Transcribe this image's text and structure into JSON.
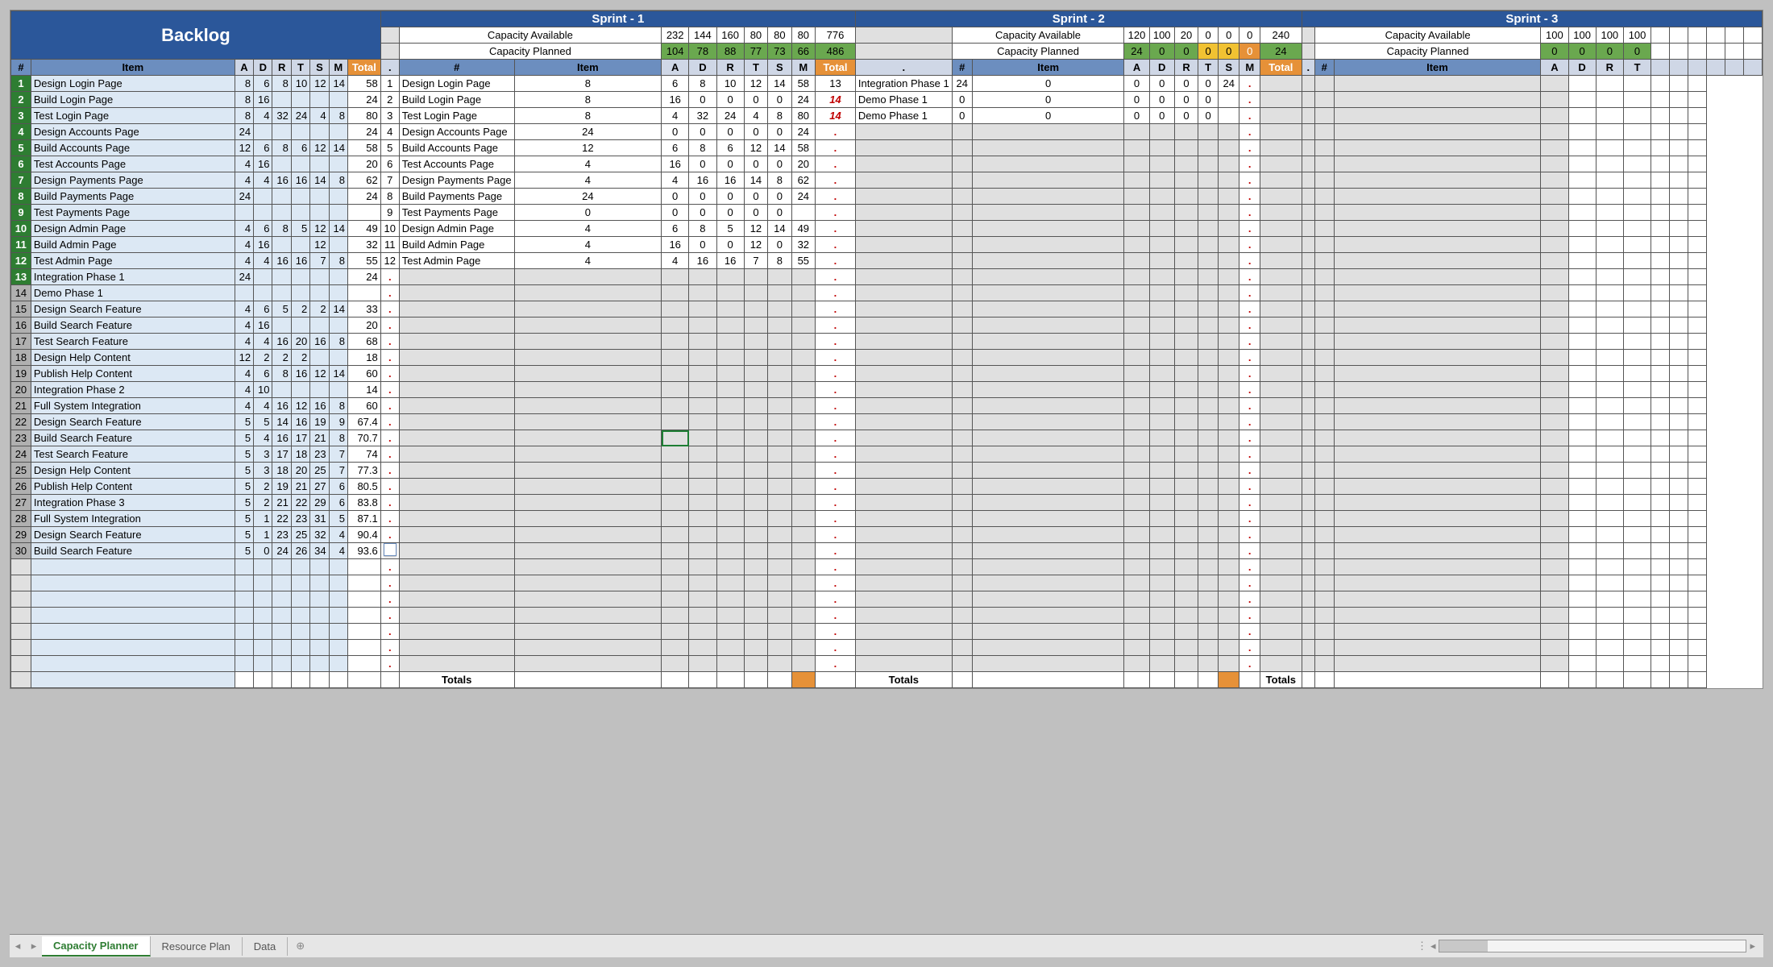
{
  "title": "Backlog",
  "sprints": [
    "Sprint - 1",
    "Sprint - 2",
    "Sprint - 3"
  ],
  "capLabels": {
    "avail": "Capacity Available",
    "plan": "Capacity Planned"
  },
  "cols": {
    "num": "#",
    "item": "Item",
    "a": "A",
    "d": "D",
    "r": "R",
    "t": "T",
    "s": "S",
    "m": "M",
    "total": "Total",
    "dot": "."
  },
  "cap": {
    "s1": {
      "avail": [
        232,
        144,
        160,
        80,
        80,
        80
      ],
      "availTot": 776,
      "plan": [
        104,
        78,
        88,
        77,
        73,
        66
      ],
      "planTot": 486
    },
    "s2": {
      "avail": [
        120,
        100,
        20,
        0,
        0,
        0
      ],
      "availTot": 240,
      "plan": [
        24,
        0,
        0,
        0,
        0,
        0
      ],
      "planTot": 24
    },
    "s3": {
      "avail": [
        100,
        100,
        100,
        100
      ],
      "plan": [
        0,
        0,
        0,
        0
      ]
    }
  },
  "backlog": [
    {
      "n": 1,
      "item": "Design Login Page",
      "v": [
        8,
        6,
        8,
        10,
        12,
        14
      ],
      "tot": 58,
      "g": 1
    },
    {
      "n": 2,
      "item": "Build Login Page",
      "v": [
        8,
        16,
        "",
        "",
        "",
        ""
      ],
      "tot": 24,
      "g": 1
    },
    {
      "n": 3,
      "item": "Test Login Page",
      "v": [
        8,
        4,
        32,
        24,
        4,
        8
      ],
      "tot": 80,
      "g": 1
    },
    {
      "n": 4,
      "item": "Design Accounts Page",
      "v": [
        24,
        "",
        "",
        "",
        "",
        ""
      ],
      "tot": 24,
      "g": 1
    },
    {
      "n": 5,
      "item": "Build Accounts Page",
      "v": [
        12,
        6,
        8,
        6,
        12,
        14
      ],
      "tot": 58,
      "g": 1
    },
    {
      "n": 6,
      "item": "Test Accounts Page",
      "v": [
        4,
        16,
        "",
        "",
        "",
        ""
      ],
      "tot": 20,
      "g": 1
    },
    {
      "n": 7,
      "item": "Design Payments Page",
      "v": [
        4,
        4,
        16,
        16,
        14,
        8
      ],
      "tot": 62,
      "g": 1
    },
    {
      "n": 8,
      "item": "Build Payments Page",
      "v": [
        24,
        "",
        "",
        "",
        "",
        ""
      ],
      "tot": 24,
      "g": 1
    },
    {
      "n": 9,
      "item": "Test Payments Page",
      "v": [
        "",
        "",
        "",
        "",
        "",
        ""
      ],
      "tot": "",
      "g": 1
    },
    {
      "n": 10,
      "item": "Design Admin Page",
      "v": [
        4,
        6,
        8,
        5,
        12,
        14
      ],
      "tot": 49,
      "g": 1
    },
    {
      "n": 11,
      "item": "Build Admin Page",
      "v": [
        4,
        16,
        "",
        "",
        12,
        ""
      ],
      "tot": 32,
      "g": 1
    },
    {
      "n": 12,
      "item": "Test Admin Page",
      "v": [
        4,
        4,
        16,
        16,
        7,
        8
      ],
      "tot": 55,
      "g": 1
    },
    {
      "n": 13,
      "item": "Integration Phase 1",
      "v": [
        24,
        "",
        "",
        "",
        "",
        ""
      ],
      "tot": 24,
      "g": 1
    },
    {
      "n": 14,
      "item": "Demo Phase 1",
      "v": [
        "",
        "",
        "",
        "",
        "",
        ""
      ],
      "tot": "",
      "g": 0
    },
    {
      "n": 15,
      "item": "Design Search Feature",
      "v": [
        4,
        6,
        5,
        2,
        2,
        14
      ],
      "tot": 33,
      "g": 0
    },
    {
      "n": 16,
      "item": "Build Search Feature",
      "v": [
        4,
        16,
        "",
        "",
        "",
        ""
      ],
      "tot": 20,
      "g": 0
    },
    {
      "n": 17,
      "item": "Test Search Feature",
      "v": [
        4,
        4,
        16,
        20,
        16,
        8
      ],
      "tot": 68,
      "g": 0
    },
    {
      "n": 18,
      "item": "Design Help Content",
      "v": [
        12,
        2,
        2,
        2,
        "",
        ""
      ],
      "tot": 18,
      "g": 0
    },
    {
      "n": 19,
      "item": "Publish Help Content",
      "v": [
        4,
        6,
        8,
        16,
        12,
        14
      ],
      "tot": 60,
      "g": 0
    },
    {
      "n": 20,
      "item": "Integration Phase 2",
      "v": [
        4,
        10,
        "",
        "",
        "",
        ""
      ],
      "tot": 14,
      "g": 0
    },
    {
      "n": 21,
      "item": "Full System Integration",
      "v": [
        4,
        4,
        16,
        12,
        16,
        8
      ],
      "tot": 60,
      "g": 0
    },
    {
      "n": 22,
      "item": "Design Search Feature",
      "v": [
        5,
        5,
        14,
        16,
        19,
        9
      ],
      "tot": 67.4,
      "g": 0
    },
    {
      "n": 23,
      "item": "Build Search Feature",
      "v": [
        5,
        4,
        16,
        17,
        21,
        8
      ],
      "tot": 70.7,
      "g": 0
    },
    {
      "n": 24,
      "item": "Test Search Feature",
      "v": [
        5,
        3,
        17,
        18,
        23,
        7
      ],
      "tot": 74,
      "g": 0
    },
    {
      "n": 25,
      "item": "Design Help Content",
      "v": [
        5,
        3,
        18,
        20,
        25,
        7
      ],
      "tot": 77.3,
      "g": 0
    },
    {
      "n": 26,
      "item": "Publish Help Content",
      "v": [
        5,
        2,
        19,
        21,
        27,
        6
      ],
      "tot": 80.5,
      "g": 0
    },
    {
      "n": 27,
      "item": "Integration Phase 3",
      "v": [
        5,
        2,
        21,
        22,
        29,
        6
      ],
      "tot": 83.8,
      "g": 0
    },
    {
      "n": 28,
      "item": "Full System Integration",
      "v": [
        5,
        1,
        22,
        23,
        31,
        5
      ],
      "tot": 87.1,
      "g": 0
    },
    {
      "n": 29,
      "item": "Design Search Feature",
      "v": [
        5,
        1,
        23,
        25,
        32,
        4
      ],
      "tot": 90.4,
      "g": 0
    },
    {
      "n": 30,
      "item": "Build Search Feature",
      "v": [
        5,
        0,
        24,
        26,
        34,
        4
      ],
      "tot": 93.6,
      "g": 0
    }
  ],
  "sprint1": [
    {
      "n": 1,
      "item": "Design Login Page",
      "v": [
        8,
        6,
        8,
        10,
        12,
        14
      ],
      "tot": 58
    },
    {
      "n": 2,
      "item": "Build Login Page",
      "v": [
        8,
        16,
        0,
        0,
        0,
        0
      ],
      "tot": 24
    },
    {
      "n": 3,
      "item": "Test Login Page",
      "v": [
        8,
        4,
        32,
        24,
        4,
        8
      ],
      "tot": 80
    },
    {
      "n": 4,
      "item": "Design Accounts Page",
      "v": [
        24,
        0,
        0,
        0,
        0,
        0
      ],
      "tot": 24
    },
    {
      "n": 5,
      "item": "Build Accounts Page",
      "v": [
        12,
        6,
        8,
        6,
        12,
        14
      ],
      "tot": 58
    },
    {
      "n": 6,
      "item": "Test Accounts Page",
      "v": [
        4,
        16,
        0,
        0,
        0,
        0
      ],
      "tot": 20
    },
    {
      "n": 7,
      "item": "Design Payments Page",
      "v": [
        4,
        4,
        16,
        16,
        14,
        8
      ],
      "tot": 62
    },
    {
      "n": 8,
      "item": "Build Payments Page",
      "v": [
        24,
        0,
        0,
        0,
        0,
        0
      ],
      "tot": 24
    },
    {
      "n": 9,
      "item": "Test Payments Page",
      "v": [
        0,
        0,
        0,
        0,
        0,
        0
      ],
      "tot": ""
    },
    {
      "n": 10,
      "item": "Design Admin Page",
      "v": [
        4,
        6,
        8,
        5,
        12,
        14
      ],
      "tot": 49
    },
    {
      "n": 11,
      "item": "Build Admin Page",
      "v": [
        4,
        16,
        0,
        0,
        12,
        0
      ],
      "tot": 32
    },
    {
      "n": 12,
      "item": "Test Admin Page",
      "v": [
        4,
        4,
        16,
        16,
        7,
        8
      ],
      "tot": 55
    }
  ],
  "sprint2": [
    {
      "n": 13,
      "item": "Integration Phase 1",
      "v": [
        24,
        0,
        0,
        0,
        0,
        0
      ],
      "tot": 24,
      "red": 0
    },
    {
      "n": 14,
      "item": "Demo Phase 1",
      "v": [
        0,
        0,
        0,
        0,
        0,
        0
      ],
      "tot": "",
      "red": 1
    },
    {
      "n": 14,
      "item": "Demo Phase 1",
      "v": [
        0,
        0,
        0,
        0,
        0,
        0
      ],
      "tot": "",
      "red": 1
    }
  ],
  "tabs": {
    "active": "Capacity Planner",
    "others": [
      "Resource Plan",
      "Data"
    ]
  },
  "totalsLabel": "Totals"
}
